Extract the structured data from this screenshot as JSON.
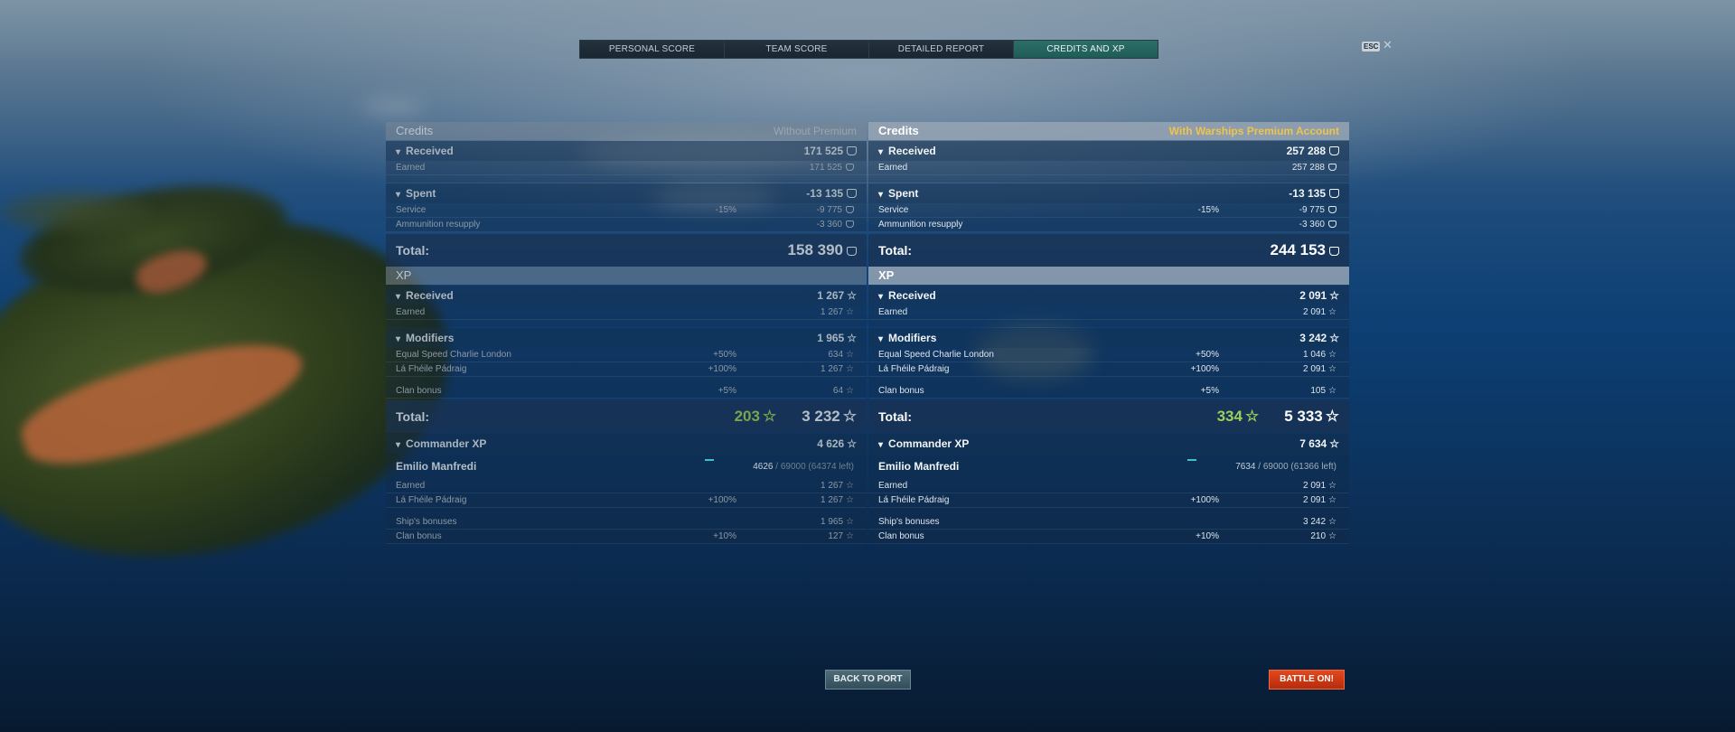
{
  "tabs": [
    "PERSONAL SCORE",
    "TEAM SCORE",
    "DETAILED REPORT",
    "CREDITS AND XP"
  ],
  "active_tab": 3,
  "esc_label": "ESC",
  "close_symbol": "✕",
  "left": {
    "credits_title": "Credits",
    "credits_mode": "Without Premium",
    "received_label": "Received",
    "received_value": "171 525",
    "earned_label": "Earned",
    "earned_value": "171 525",
    "spent_label": "Spent",
    "spent_value": "-13 135",
    "service_label": "Service",
    "service_pct": "-15%",
    "service_value": "-9 775",
    "ammo_label": "Ammunition resupply",
    "ammo_value": "-3 360",
    "credits_total_label": "Total:",
    "credits_total": "158 390",
    "xp_title": "XP",
    "xp_received_label": "Received",
    "xp_received_value": "1 267",
    "xp_earned_label": "Earned",
    "xp_earned_value": "1 267",
    "modifiers_label": "Modifiers",
    "modifiers_value": "1 965",
    "mod1_label": "Equal Speed Charlie London",
    "mod1_pct": "+50%",
    "mod1_value": "634",
    "mod2_label": "Lá Fhéile Pádraig",
    "mod2_pct": "+100%",
    "mod2_value": "1 267",
    "clan_label": "Clan bonus",
    "clan_pct": "+5%",
    "clan_value": "64",
    "xp_total_label": "Total:",
    "xp_total_free": "203",
    "xp_total": "3 232",
    "cmd_label": "Commander XP",
    "cmd_value": "4 626",
    "cmd_name": "Emilio Manfredi",
    "cmd_cur": "4626",
    "cmd_rest": "/ 69000 (64374 left)",
    "cmd_earned_label": "Earned",
    "cmd_earned_value": "1 267",
    "cmd_mod_label": "Lá Fhéile Pádraig",
    "cmd_mod_pct": "+100%",
    "cmd_mod_value": "1 267",
    "ship_bonus_label": "Ship's bonuses",
    "ship_bonus_value": "1 965",
    "cmd_clan_label": "Clan bonus",
    "cmd_clan_pct": "+10%",
    "cmd_clan_value": "127"
  },
  "right": {
    "credits_title": "Credits",
    "credits_mode": "With Warships Premium Account",
    "received_label": "Received",
    "received_value": "257 288",
    "earned_label": "Earned",
    "earned_value": "257 288",
    "spent_label": "Spent",
    "spent_value": "-13 135",
    "service_label": "Service",
    "service_pct": "-15%",
    "service_value": "-9 775",
    "ammo_label": "Ammunition resupply",
    "ammo_value": "-3 360",
    "credits_total_label": "Total:",
    "credits_total": "244 153",
    "xp_title": "XP",
    "xp_received_label": "Received",
    "xp_received_value": "2 091",
    "xp_earned_label": "Earned",
    "xp_earned_value": "2 091",
    "modifiers_label": "Modifiers",
    "modifiers_value": "3 242",
    "mod1_label": "Equal Speed Charlie London",
    "mod1_pct": "+50%",
    "mod1_value": "1 046",
    "mod2_label": "Lá Fhéile Pádraig",
    "mod2_pct": "+100%",
    "mod2_value": "2 091",
    "clan_label": "Clan bonus",
    "clan_pct": "+5%",
    "clan_value": "105",
    "xp_total_label": "Total:",
    "xp_total_free": "334",
    "xp_total": "5 333",
    "cmd_label": "Commander XP",
    "cmd_value": "7 634",
    "cmd_name": "Emilio Manfredi",
    "cmd_cur": "7634",
    "cmd_rest": "/ 69000 (61366 left)",
    "cmd_earned_label": "Earned",
    "cmd_earned_value": "2 091",
    "cmd_mod_label": "Lá Fhéile Pádraig",
    "cmd_mod_pct": "+100%",
    "cmd_mod_value": "2 091",
    "ship_bonus_label": "Ship's bonuses",
    "ship_bonus_value": "3 242",
    "cmd_clan_label": "Clan bonus",
    "cmd_clan_pct": "+10%",
    "cmd_clan_value": "210"
  },
  "buttons": {
    "back_to_port": "BACK TO PORT",
    "battle": "BATTLE ON!"
  },
  "icons": {
    "credit": "credit-coin-icon",
    "xp": "star-icon"
  },
  "colors": {
    "active_tab": "#2c6e68",
    "premium_label": "#f0c34a",
    "free_xp": "#9bcf5a",
    "battle_button": "#e3481e"
  }
}
